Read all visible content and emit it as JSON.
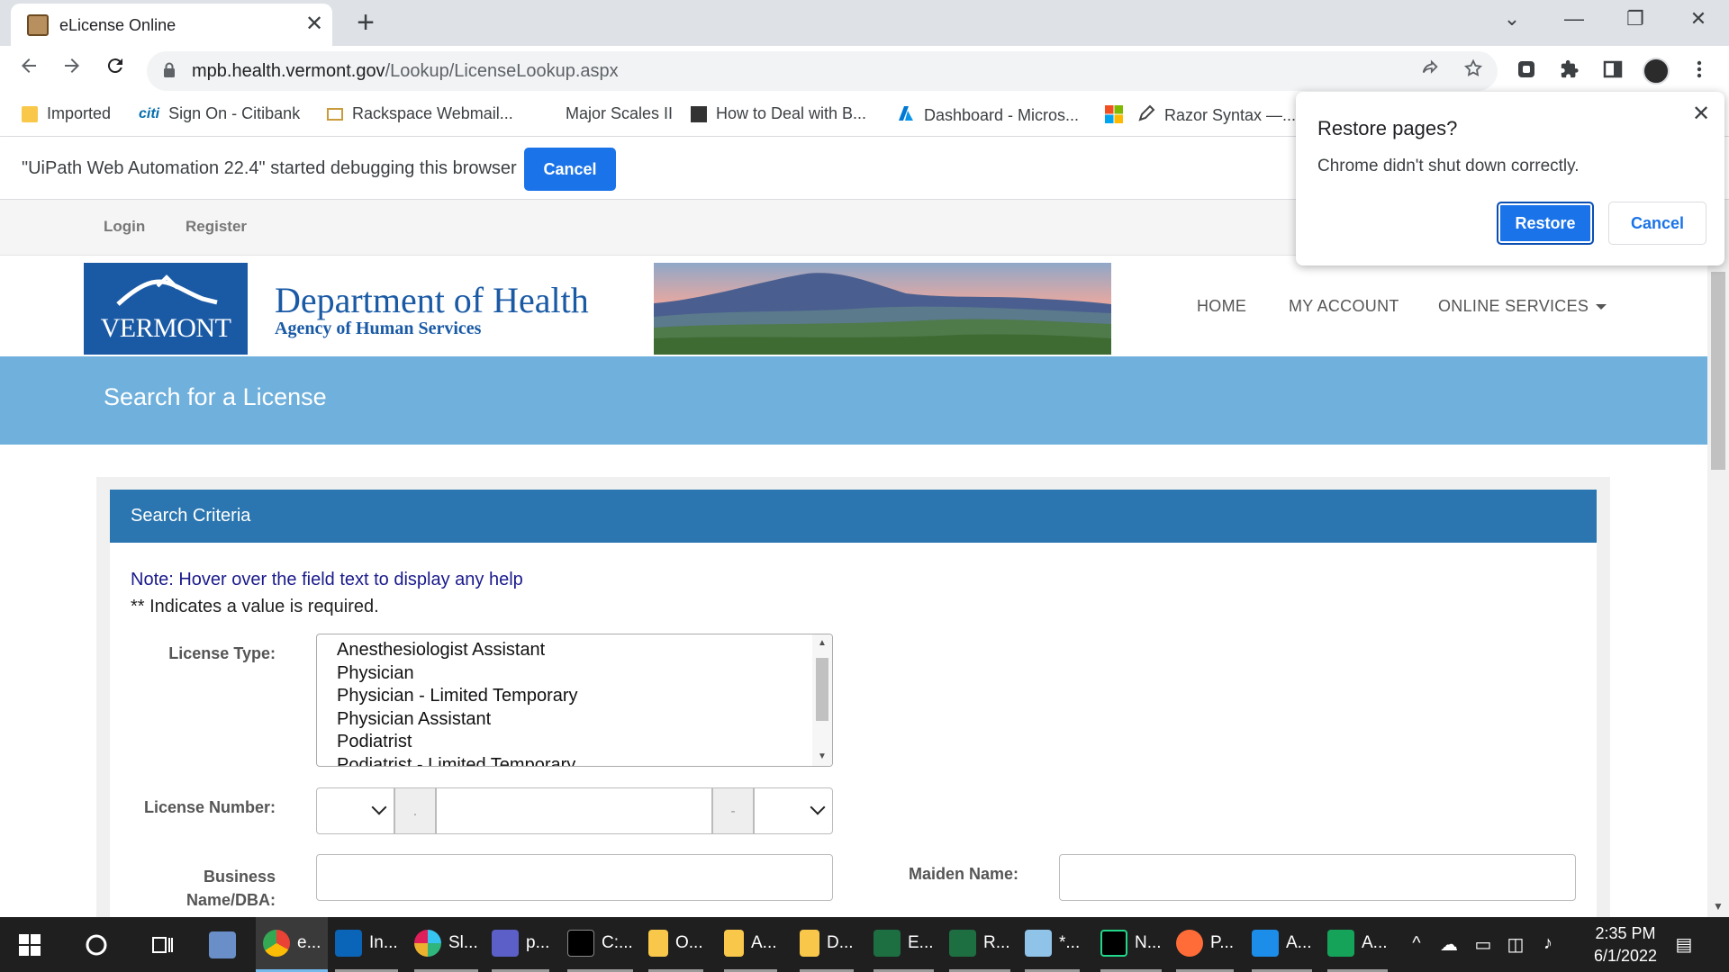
{
  "browser": {
    "tab_title": "eLicense Online",
    "tab_close": "✕",
    "new_tab": "+",
    "window_controls": [
      "⌄",
      "—",
      "❐",
      "✕"
    ],
    "url_host": "mpb.health.vermont.gov",
    "url_path": "/Lookup/LicenseLookup.aspx",
    "nav_icons": [
      "back-arrow-icon",
      "forward-arrow-icon",
      "reload-icon"
    ]
  },
  "bookmarks": [
    {
      "label": "Imported",
      "icon": "folder-icon",
      "color": "#f9c84a"
    },
    {
      "label": "Sign On - Citibank",
      "icon": "citi-icon",
      "color": "#056dae"
    },
    {
      "label": "Rackspace Webmail...",
      "icon": "mail-icon",
      "color": "#c99b3b"
    },
    {
      "label": "Major Scales II",
      "icon": "",
      "color": ""
    },
    {
      "label": "How to Deal with B...",
      "icon": "book-icon",
      "color": "#333333"
    },
    {
      "label": "Dashboard - Micros...",
      "icon": "azure-icon",
      "color": "#0078d4"
    },
    {
      "label": "",
      "icon": "microsoft-icon",
      "color": "#f25022"
    },
    {
      "label": "Razor Syntax —...",
      "icon": "pen-icon",
      "color": "#444444"
    }
  ],
  "infobar": {
    "message": "\"UiPath Web Automation 22.4\" started debugging this browser",
    "cancel_label": "Cancel"
  },
  "popup": {
    "title": "Restore pages?",
    "message": "Chrome didn't shut down correctly.",
    "restore_label": "Restore",
    "cancel_label": "Cancel",
    "close": "✕"
  },
  "site": {
    "topnav": {
      "login": "Login",
      "register": "Register"
    },
    "logo_text": "VERMONT",
    "dept_title": "Department of Health",
    "dept_subtitle": "Agency of Human Services",
    "mainnav": {
      "home": "HOME",
      "account": "MY ACCOUNT",
      "services": "ONLINE SERVICES"
    },
    "banner_title": "Search for a License",
    "criteria_title": "Search Criteria",
    "note": "Note:  Hover over the field text to display any help",
    "required_note": "** Indicates a value is required.",
    "labels": {
      "license_type": "License Type:",
      "license_number": "License Number:",
      "business_name_1": "Business",
      "business_name_2": "Name/DBA:",
      "maiden_name": "Maiden Name:"
    },
    "license_types": [
      "Anesthesiologist Assistant",
      "Physician",
      "Physician - Limited Temporary",
      "Physician Assistant",
      "Podiatrist",
      "Podiatrist - Limited Temporary"
    ],
    "license_number_separators": [
      ".",
      "-"
    ]
  },
  "taskbar": {
    "items": [
      {
        "label": "",
        "icon": "task-view-icon"
      },
      {
        "label": "e...",
        "icon": "chrome-icon"
      },
      {
        "label": "In...",
        "icon": "outlook-icon"
      },
      {
        "label": "Sl...",
        "icon": "slack-icon"
      },
      {
        "label": "p...",
        "icon": "teams-icon"
      },
      {
        "label": "C:...",
        "icon": "terminal-icon"
      },
      {
        "label": "O...",
        "icon": "folder-icon"
      },
      {
        "label": "A...",
        "icon": "folder-icon"
      },
      {
        "label": "D...",
        "icon": "folder-icon"
      },
      {
        "label": "E...",
        "icon": "excel-icon"
      },
      {
        "label": "R...",
        "icon": "excel-icon"
      },
      {
        "label": "*...",
        "icon": "notepad-icon"
      },
      {
        "label": "N...",
        "icon": "pycharm-icon"
      },
      {
        "label": "P...",
        "icon": "postman-icon"
      },
      {
        "label": "A...",
        "icon": "uipath-studio-icon"
      },
      {
        "label": "A...",
        "icon": "uipath-assistant-icon"
      }
    ],
    "time": "2:35 PM",
    "date": "6/1/2022"
  },
  "colors": {
    "banner": "#6fb0dc",
    "criteria_header": "#2b76b0",
    "vermont_blue": "#1a5aa5",
    "chrome_blue": "#1a73e8"
  }
}
